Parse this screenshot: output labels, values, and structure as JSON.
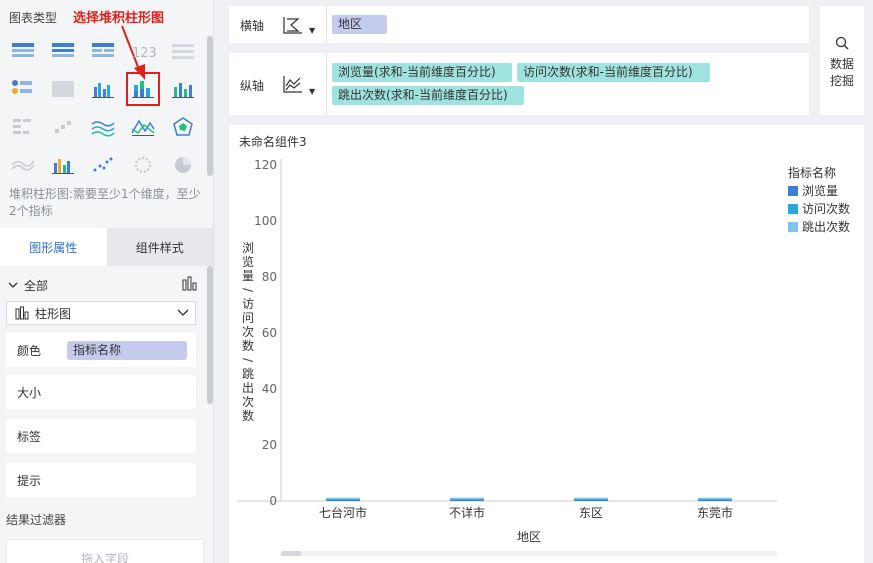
{
  "left_panel": {
    "title": "图表类型",
    "annotation": "选择堆积柱形图",
    "description": "堆积柱形图:需要至少1个维度，至少2个指标",
    "tabs": [
      {
        "label": "图形属性",
        "active": true
      },
      {
        "label": "组件样式",
        "active": false
      }
    ],
    "all_label": "全部",
    "chart_select": "柱形图",
    "properties": [
      {
        "label": "颜色",
        "value": "指标名称"
      },
      {
        "label": "大小"
      },
      {
        "label": "标签"
      },
      {
        "label": "提示"
      }
    ],
    "filter_title": "结果过滤器",
    "drop_placeholder": "拖入字段"
  },
  "axes": {
    "x_label": "横轴",
    "x_fields": [
      "地区"
    ],
    "y_label": "纵轴",
    "y_fields": [
      "浏览量(求和-当前维度百分比)",
      "访问次数(求和-当前维度百分比)",
      "跳出次数(求和-当前维度百分比)"
    ]
  },
  "mining": {
    "line1": "数据",
    "line2": "挖掘"
  },
  "chart": {
    "title": "未命名组件3"
  },
  "chart_data": {
    "type": "bar",
    "stacked": true,
    "categories": [
      "七台河市",
      "不详市",
      "东区",
      "东莞市"
    ],
    "series": [
      {
        "name": "浏览量",
        "color": "#3d7fd6",
        "values": [
          0.4,
          0.4,
          0.4,
          0.4
        ]
      },
      {
        "name": "访问次数",
        "color": "#26a8dc",
        "values": [
          0.4,
          0.4,
          0.4,
          0.4
        ]
      },
      {
        "name": "跳出次数",
        "color": "#7fc4f0",
        "values": [
          0.4,
          0.4,
          0.4,
          0.4
        ]
      }
    ],
    "xlabel": "地区",
    "ylabel": "浏览量/访问次数/跳出次数",
    "ylim": [
      0,
      120
    ],
    "yticks": [
      0,
      20,
      40,
      60,
      80,
      100,
      120
    ],
    "legend_title": "指标名称",
    "legend_position": "right",
    "grid": false
  }
}
